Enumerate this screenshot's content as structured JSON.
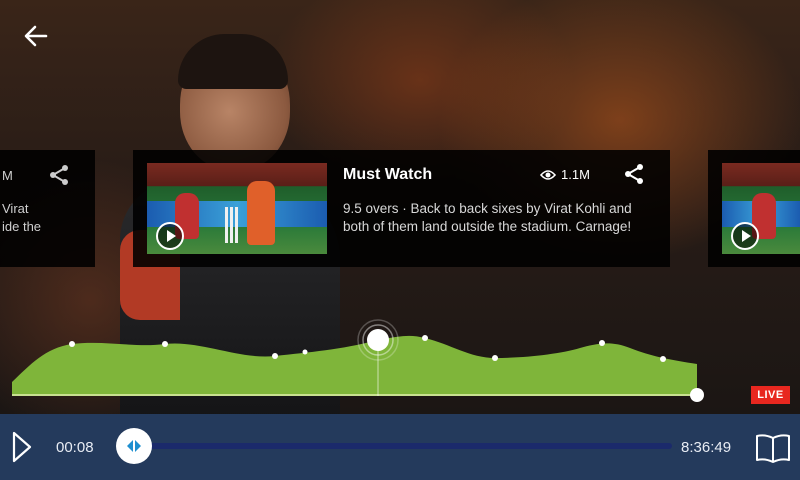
{
  "header": {
    "back_icon": "arrow-left-icon"
  },
  "cards": {
    "main": {
      "title": "Must Watch",
      "views": "1.1M",
      "description": "9.5 overs · Back to back sixes by Virat Kohli and both of them land outside the stadium. Carnage!",
      "view_icon": "eye-icon",
      "share_icon": "share-icon"
    },
    "left_partial": {
      "views": "M",
      "text_line1": "Virat",
      "text_line2": "ide the"
    }
  },
  "live_badge": "LIVE",
  "player": {
    "elapsed": "00:08",
    "total": "8:36:49",
    "play_icon": "play-icon",
    "book_icon": "book-open-icon",
    "accent": "#243a5c"
  },
  "colors": {
    "live": "#e8271f",
    "chart_fill": "#7fb53a",
    "track": "#1b2a6b"
  }
}
